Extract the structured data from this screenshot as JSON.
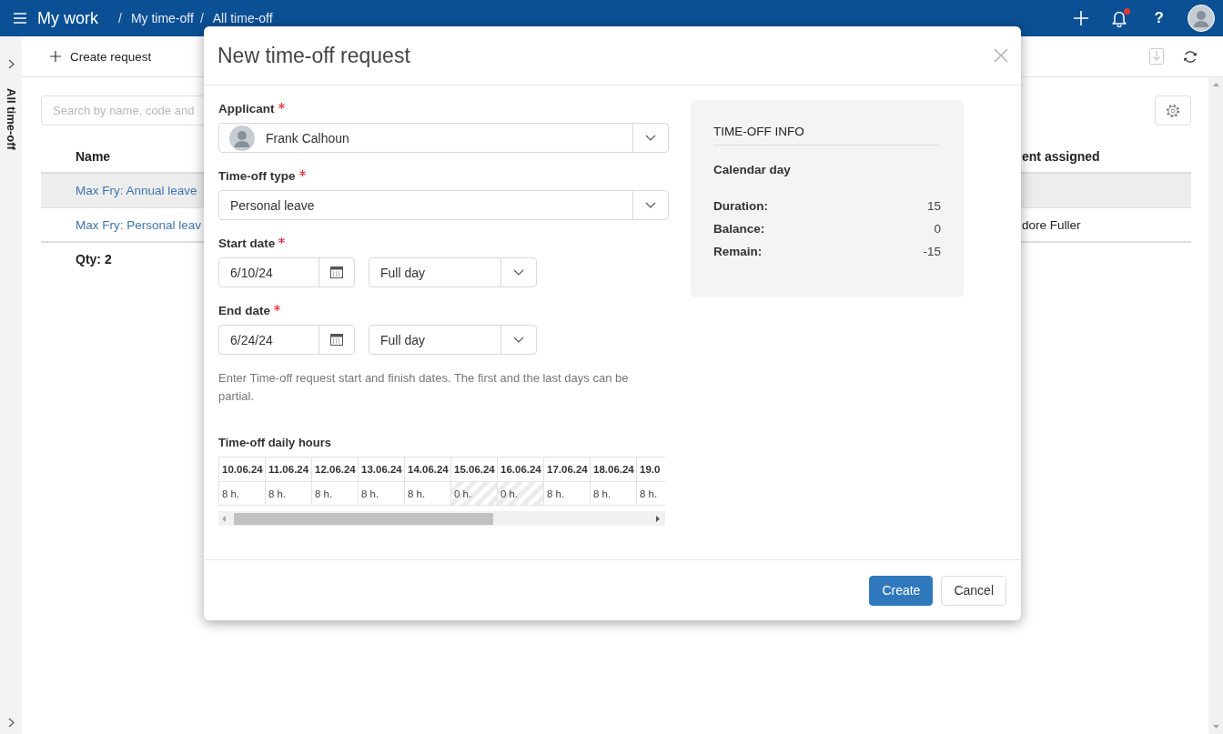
{
  "top_bar": {
    "app_title": "My work",
    "breadcrumbs": [
      {
        "separator": "/",
        "label": "My time-off"
      },
      {
        "separator": "/",
        "label": "All time-off"
      }
    ],
    "has_notifications": true,
    "help": "?"
  },
  "side_rail": {
    "title": "All time-off"
  },
  "toolbar": {
    "create_label": "Create request",
    "export_disabled": true
  },
  "list": {
    "search": {
      "placeholder": "Search by name, code and"
    },
    "table": {
      "columns": [
        "Name",
        "ent assigned"
      ],
      "rows": [
        {
          "name": "Max Fry: Annual leave",
          "highlighted": true
        },
        {
          "name": "Max Fry: Personal leav",
          "column_2": "dore Fuller",
          "highlighted": false
        }
      ],
      "footer": "Qty: 2"
    }
  },
  "dialog": {
    "title": "New time-off request",
    "fields": [
      {
        "kind": "person_select",
        "label": "Applicant",
        "required": true,
        "value": "Frank Calhoun"
      },
      {
        "kind": "select",
        "label": "Time-off type",
        "required": true,
        "value": "Personal leave"
      },
      {
        "kind": "date",
        "label": "Start date",
        "required": true,
        "value": "6/10/24",
        "day_part": "Full day"
      },
      {
        "kind": "date",
        "label": "End date",
        "required": true,
        "value": "6/24/24",
        "day_part": "Full day"
      }
    ],
    "hint": "Enter Time-off request start and finish dates. The first and the last days can be partial.",
    "daily_hours": {
      "title": "Time-off daily hours",
      "days": [
        {
          "date": "10.06.24",
          "hours": "8 h.",
          "non_working": false
        },
        {
          "date": "11.06.24",
          "hours": "8 h.",
          "non_working": false
        },
        {
          "date": "12.06.24",
          "hours": "8 h.",
          "non_working": false
        },
        {
          "date": "13.06.24",
          "hours": "8 h.",
          "non_working": false
        },
        {
          "date": "14.06.24",
          "hours": "8 h.",
          "non_working": false
        },
        {
          "date": "15.06.24",
          "hours": "0 h.",
          "non_working": true
        },
        {
          "date": "16.06.24",
          "hours": "0 h.",
          "non_working": true
        },
        {
          "date": "17.06.24",
          "hours": "8 h.",
          "non_working": false
        },
        {
          "date": "18.06.24",
          "hours": "8 h.",
          "non_working": false
        },
        {
          "date": "19.0",
          "hours": "8 h.",
          "non_working": false
        }
      ]
    },
    "info": {
      "title": "TIME-OFF INFO",
      "subtitle": "Calendar day",
      "rows": [
        {
          "label": "Duration:",
          "value": "15"
        },
        {
          "label": "Balance:",
          "value": "0"
        },
        {
          "label": "Remain:",
          "value": "-15"
        }
      ]
    },
    "buttons": [
      {
        "label": "Create",
        "kind": "primary"
      },
      {
        "label": "Cancel",
        "kind": "secondary"
      }
    ]
  }
}
